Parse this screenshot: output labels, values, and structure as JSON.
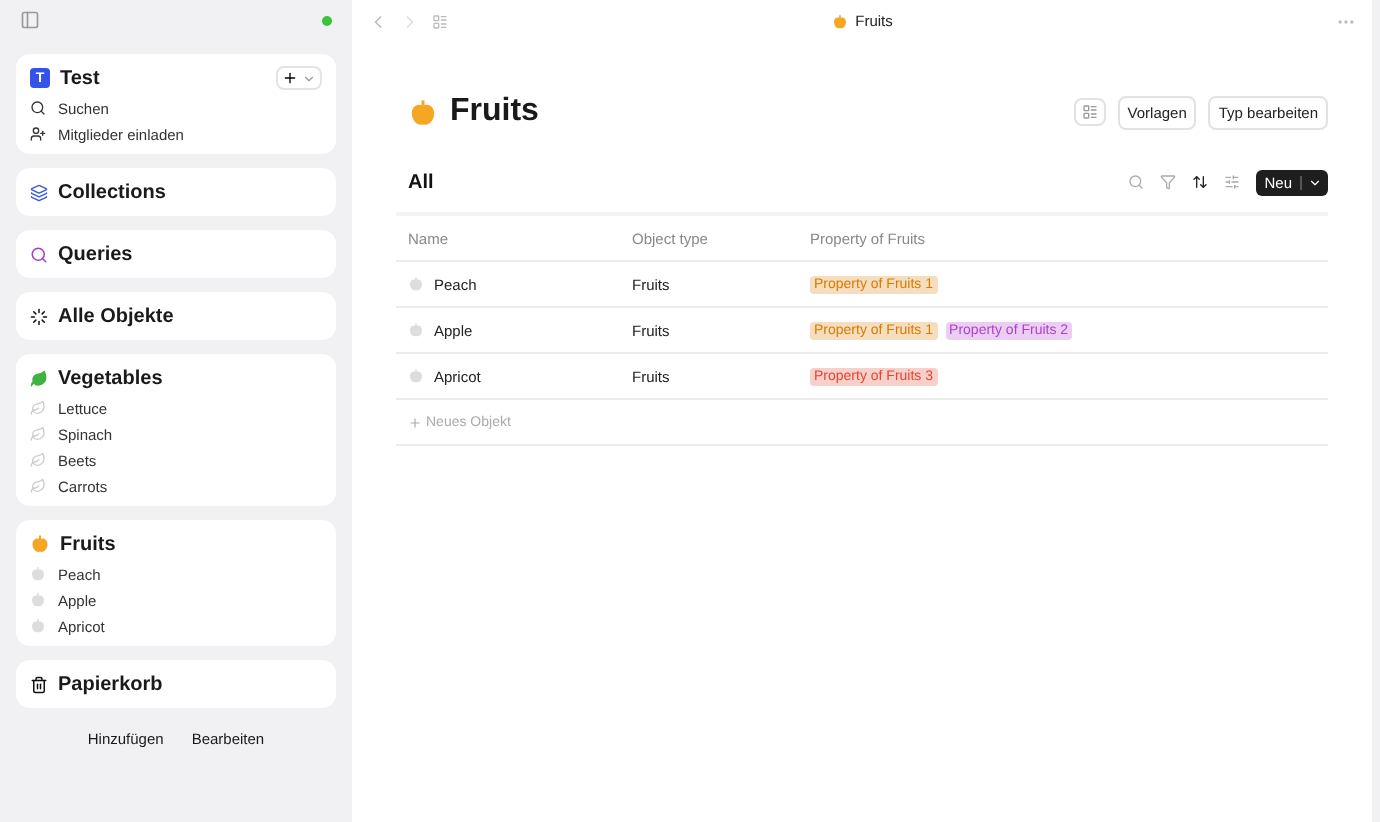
{
  "sidebar": {
    "space": {
      "badge": "T",
      "name": "Test",
      "actions": [
        "Suchen",
        "Mitglieder einladen"
      ]
    },
    "sections": [
      {
        "kind": "collections",
        "title": "Collections"
      },
      {
        "kind": "queries",
        "title": "Queries"
      },
      {
        "kind": "objects",
        "title": "Alle Objekte"
      },
      {
        "kind": "leaf",
        "title": "Vegetables",
        "items": [
          "Lettuce",
          "Spinach",
          "Beets",
          "Carrots"
        ]
      },
      {
        "kind": "fruit",
        "title": "Fruits",
        "items": [
          "Peach",
          "Apple",
          "Apricot"
        ]
      },
      {
        "kind": "bin",
        "title": "Papierkorb"
      }
    ],
    "footer": [
      "Hinzufügen",
      "Bearbeiten"
    ]
  },
  "topbar": {
    "title": "Fruits"
  },
  "page": {
    "title": "Fruits",
    "buttons": [
      "Vorlagen",
      "Typ bearbeiten"
    ],
    "view": "All",
    "new_button": "Neu",
    "table": {
      "columns": [
        "Name",
        "Object type",
        "Property of Fruits"
      ],
      "rows": [
        {
          "name": "Peach",
          "type": "Fruits",
          "tags": [
            {
              "label": "Property of Fruits 1",
              "color": "#d97a00"
            }
          ]
        },
        {
          "name": "Apple",
          "type": "Fruits",
          "tags": [
            {
              "label": "Property of Fruits 1",
              "color": "#d97a00"
            },
            {
              "label": "Property of Fruits 2",
              "color": "#b03fd0"
            }
          ]
        },
        {
          "name": "Apricot",
          "type": "Fruits",
          "tags": [
            {
              "label": "Property of Fruits 3",
              "color": "#e5452f"
            }
          ]
        }
      ],
      "new_row": "Neues Objekt"
    }
  }
}
